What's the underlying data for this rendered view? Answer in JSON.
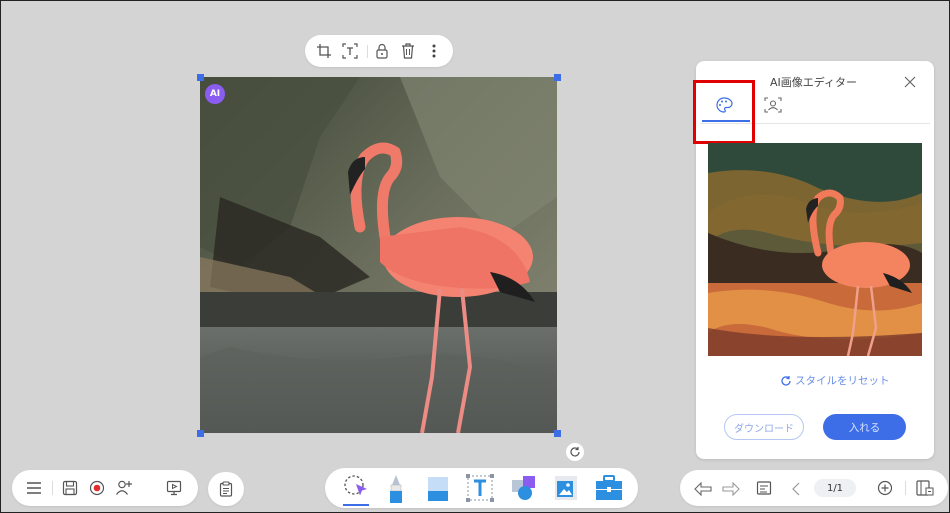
{
  "canvas": {
    "ai_badge": "AI",
    "image_description_alt": "Flamingo photo"
  },
  "image_toolbar": {
    "icons": [
      "crop-icon",
      "text-recognize-icon",
      "lock-icon",
      "delete-icon",
      "more-icon"
    ]
  },
  "ai_panel": {
    "title": "AI画像エディター",
    "tabs": [
      {
        "icon": "palette-icon",
        "active": true
      },
      {
        "icon": "portrait-icon",
        "active": false
      }
    ],
    "reset_label": "スタイルをリセット",
    "download_label": "ダウンロード",
    "insert_label": "入れる",
    "highlight_color": "#e00000",
    "accent_color": "#3d6ee8"
  },
  "bottom_left": {
    "icons": [
      "menu-icon",
      "save-icon",
      "record-icon",
      "add-user-icon",
      "present-icon"
    ],
    "clipboard_icon": "clipboard-icon"
  },
  "tools": {
    "items": [
      "select-tool",
      "pen-tool",
      "eraser-tool",
      "text-tool",
      "shape-tool",
      "image-tool",
      "toolbox-tool"
    ],
    "active": "select-tool"
  },
  "bottom_right": {
    "page_indicator": "1/1",
    "icons": [
      "undo-icon",
      "redo-icon",
      "page-list-icon",
      "prev-page-icon",
      "add-page-icon",
      "page-manager-icon"
    ]
  }
}
